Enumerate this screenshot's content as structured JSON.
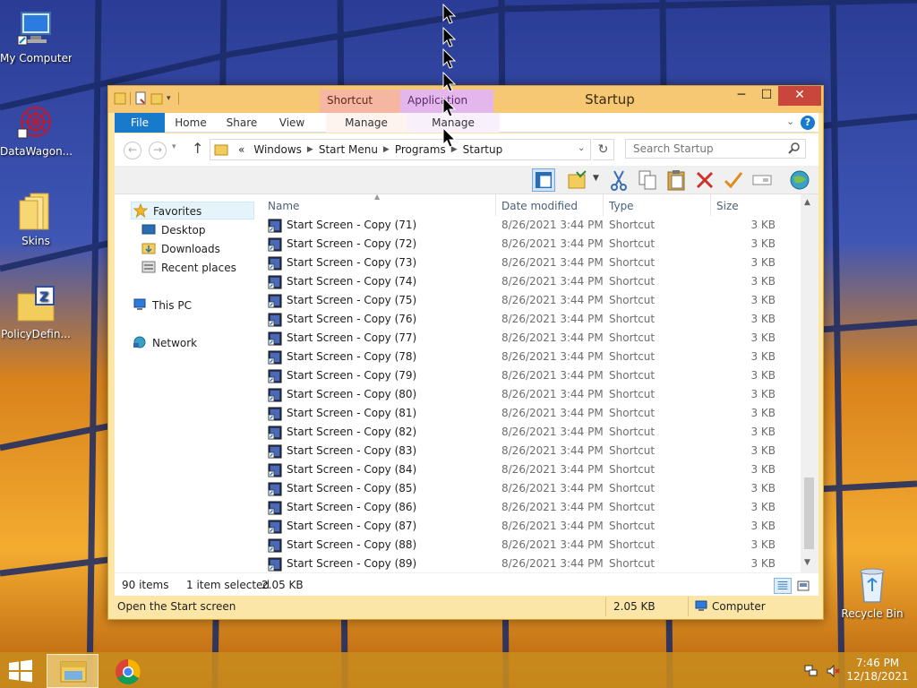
{
  "desktop": {
    "icons": [
      {
        "label": "My Computer"
      },
      {
        "label": "DataWagon..."
      },
      {
        "label": "Skins"
      },
      {
        "label": "PolicyDefin..."
      },
      {
        "label": "Recycle Bin"
      }
    ]
  },
  "window": {
    "title": "Startup",
    "context_tabs": {
      "shortcut_tools": "Shortcut Tools",
      "application_tools": "Application Tools"
    },
    "ribbon_tabs": {
      "file": "File",
      "home": "Home",
      "share": "Share",
      "view": "View",
      "manage1": "Manage",
      "manage2": "Manage"
    },
    "caption": {
      "minimize": "─",
      "maximize": "☐",
      "close": "✕"
    },
    "help": "?"
  },
  "address": {
    "prefix": "«",
    "crumbs": [
      "Windows",
      "Start Menu",
      "Programs",
      "Startup"
    ],
    "search_placeholder": "Search Startup"
  },
  "nav": {
    "favorites": "Favorites",
    "desktop": "Desktop",
    "downloads": "Downloads",
    "recent": "Recent places",
    "this_pc": "This PC",
    "network": "Network"
  },
  "columns": {
    "name": "Name",
    "date": "Date modified",
    "type": "Type",
    "size": "Size"
  },
  "files": [
    {
      "name": "Start Screen - Copy (71)",
      "date": "8/26/2021 3:44 PM",
      "type": "Shortcut",
      "size": "3 KB"
    },
    {
      "name": "Start Screen - Copy (72)",
      "date": "8/26/2021 3:44 PM",
      "type": "Shortcut",
      "size": "3 KB"
    },
    {
      "name": "Start Screen - Copy (73)",
      "date": "8/26/2021 3:44 PM",
      "type": "Shortcut",
      "size": "3 KB"
    },
    {
      "name": "Start Screen - Copy (74)",
      "date": "8/26/2021 3:44 PM",
      "type": "Shortcut",
      "size": "3 KB"
    },
    {
      "name": "Start Screen - Copy (75)",
      "date": "8/26/2021 3:44 PM",
      "type": "Shortcut",
      "size": "3 KB"
    },
    {
      "name": "Start Screen - Copy (76)",
      "date": "8/26/2021 3:44 PM",
      "type": "Shortcut",
      "size": "3 KB"
    },
    {
      "name": "Start Screen - Copy (77)",
      "date": "8/26/2021 3:44 PM",
      "type": "Shortcut",
      "size": "3 KB"
    },
    {
      "name": "Start Screen - Copy (78)",
      "date": "8/26/2021 3:44 PM",
      "type": "Shortcut",
      "size": "3 KB"
    },
    {
      "name": "Start Screen - Copy (79)",
      "date": "8/26/2021 3:44 PM",
      "type": "Shortcut",
      "size": "3 KB"
    },
    {
      "name": "Start Screen - Copy (80)",
      "date": "8/26/2021 3:44 PM",
      "type": "Shortcut",
      "size": "3 KB"
    },
    {
      "name": "Start Screen - Copy (81)",
      "date": "8/26/2021 3:44 PM",
      "type": "Shortcut",
      "size": "3 KB"
    },
    {
      "name": "Start Screen - Copy (82)",
      "date": "8/26/2021 3:44 PM",
      "type": "Shortcut",
      "size": "3 KB"
    },
    {
      "name": "Start Screen - Copy (83)",
      "date": "8/26/2021 3:44 PM",
      "type": "Shortcut",
      "size": "3 KB"
    },
    {
      "name": "Start Screen - Copy (84)",
      "date": "8/26/2021 3:44 PM",
      "type": "Shortcut",
      "size": "3 KB"
    },
    {
      "name": "Start Screen - Copy (85)",
      "date": "8/26/2021 3:44 PM",
      "type": "Shortcut",
      "size": "3 KB"
    },
    {
      "name": "Start Screen - Copy (86)",
      "date": "8/26/2021 3:44 PM",
      "type": "Shortcut",
      "size": "3 KB"
    },
    {
      "name": "Start Screen - Copy (87)",
      "date": "8/26/2021 3:44 PM",
      "type": "Shortcut",
      "size": "3 KB"
    },
    {
      "name": "Start Screen - Copy (88)",
      "date": "8/26/2021 3:44 PM",
      "type": "Shortcut",
      "size": "3 KB"
    },
    {
      "name": "Start Screen - Copy (89)",
      "date": "8/26/2021 3:44 PM",
      "type": "Shortcut",
      "size": "3 KB"
    }
  ],
  "status": {
    "count": "90 items",
    "selected": "1 item selected",
    "selected_size": "2.05 KB"
  },
  "bottombar": {
    "description": "Open the Start screen",
    "size": "2.05 KB",
    "location": "Computer"
  },
  "taskbar": {
    "time": "7:46 PM",
    "date": "12/18/2021"
  },
  "colors": {
    "accent": "#1979ca",
    "titlebar": "#f7c873",
    "close": "#c9463d"
  }
}
